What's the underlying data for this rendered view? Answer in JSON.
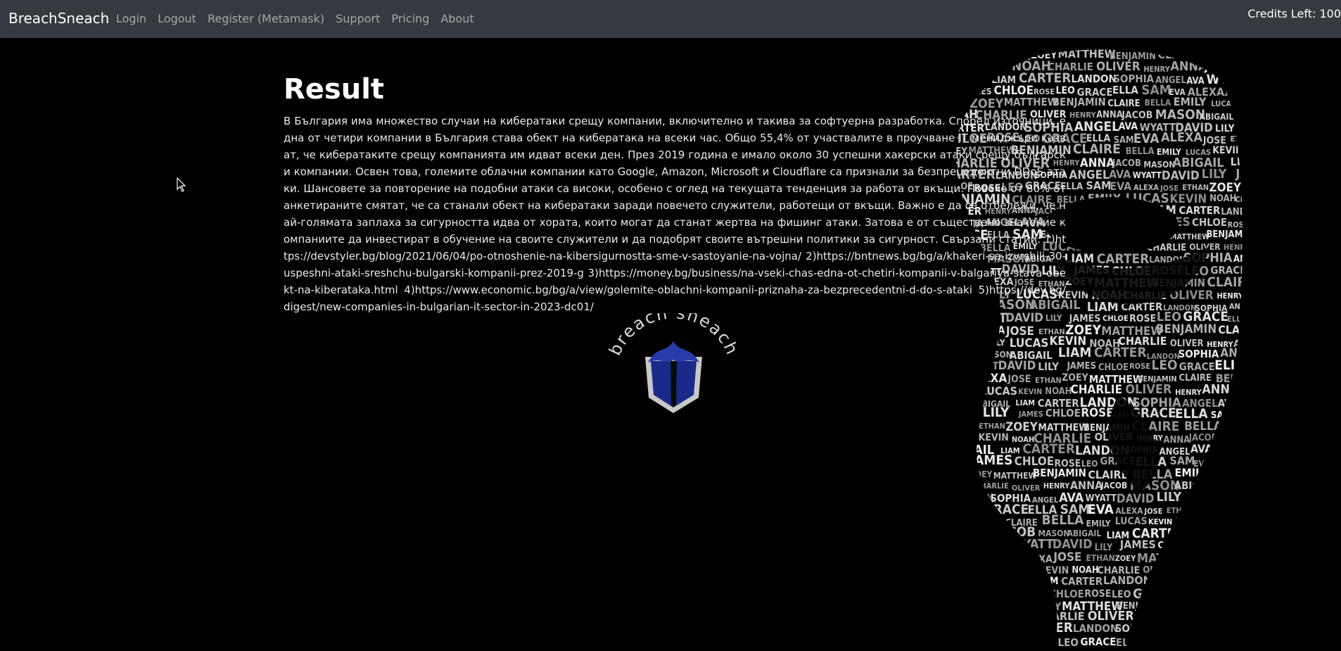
{
  "navbar": {
    "brand": "BreachSneach",
    "links": [
      "Login",
      "Logout",
      "Register (Metamask)",
      "Support",
      "Pricing",
      "About"
    ],
    "credits": "Credits Left: 100"
  },
  "main": {
    "title": "Result",
    "body": "В България има множество случаи на кибератаки срещу компании, включително и такива за софтуерна разработка. Според източници, една от четири компании в България става обект на кибератака на всеки час. Общо 55,4% от участвалите в проучване IT мениджъри казват, че кибератаките срещу компанията им идват всеки ден. През 2019 година е имало около 30 успешни хакерски атаки срещу български компании. Освен това, големите облачни компании като Google, Amazon, Microsoft и Cloudflare са признали за безпрецедентни DDoS атаки. Шансовете за повторение на подобни атаки са високи, особено с оглед на текущата тенденция за работа от вкъщи. Повече от 80% от анкетираните смятат, че са станали обект на кибератаки заради повечето служители, работещи от вкъщи. Важно е да се отбележи, че най-голямата заплаха за сигурността идва от хората, които могат да станат жертва на фишинг атаки. Затова е от съществено значение компаниите да инвестират в обучение на своите служители и да подобрят своите вътрешни политики за сигурност. Свързани статии: 1)https://devstyler.bg/blog/2021/06/04/po-otnoshenie-na-kibersigurnostta-sme-v-sastoyanie-na-vojna/ 2)https://bntnews.bg/bg/a/khakeri-sa-izvrshili-30-uspeshni-ataki-sreshchu-bulgarski-kompanii-prez-2019-g 3)https://money.bg/business/na-vseki-chas-edna-ot-chetiri-kompanii-v-balgariya-stava-obekt-na-kiberataka.html 4)https://www.economic.bg/bg/a/view/golemite-oblachni-kompanii-priznaha-za-bezprecedentni-d-do-s-ataki 5)https://dev.bg/digest/new-companies-in-bulgarian-it-sector-in-2023-dc01/"
  },
  "logo": {
    "text": "breach sneach"
  },
  "decor": {
    "names": [
      "ALEXA",
      "JOSE",
      "ETHAN",
      "ZOEY",
      "MATTHEW",
      "BENJAMIN",
      "CLAIRE",
      "BELLA",
      "EMILY",
      "LUCAS",
      "KEVIN",
      "NOAH",
      "CHARLIE",
      "OLIVER",
      "HENRY",
      "ANNA",
      "JACOB",
      "MASON",
      "ABIGAIL",
      "LIAM",
      "CARTER",
      "LANDON",
      "SOPHIA",
      "ANGEL",
      "AVA",
      "WYATT",
      "DAVID",
      "LILY",
      "JAMES",
      "CHLOE",
      "ROSE",
      "LEO",
      "GRACE",
      "ELLA",
      "SAM",
      "EVA"
    ]
  },
  "colors": {
    "navbar": "#343a40",
    "background": "#000000",
    "shield_blue": "#1a2a8a",
    "shield_gray": "#c8c8c8"
  }
}
